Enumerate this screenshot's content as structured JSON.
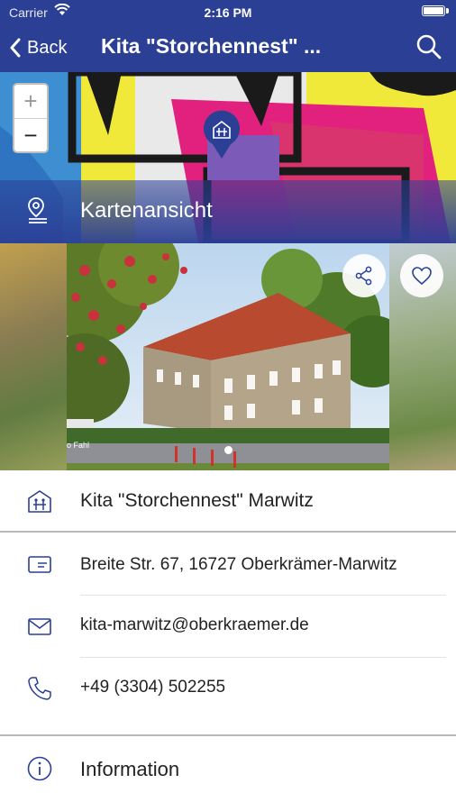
{
  "status_bar": {
    "carrier": "Carrier",
    "time": "2:16 PM"
  },
  "nav": {
    "back_label": "Back",
    "title": "Kita \"Storchennest\" ..."
  },
  "map": {
    "zoom_in": "+",
    "zoom_out": "−",
    "view_label": "Kartenansicht"
  },
  "gallery": {
    "photo_credit": "o Fahl",
    "current_index": 1,
    "total": 1
  },
  "details": {
    "title": "Kita \"Storchennest\" Marwitz",
    "address": "Breite Str. 67, 16727 Oberkrämer-Marwitz",
    "email": "kita-marwitz@oberkraemer.de",
    "phone": "+49 (3304) 502255",
    "info_label": "Information"
  },
  "colors": {
    "brand": "#2b3f95",
    "icon": "#2b3f95",
    "text": "#222222"
  }
}
